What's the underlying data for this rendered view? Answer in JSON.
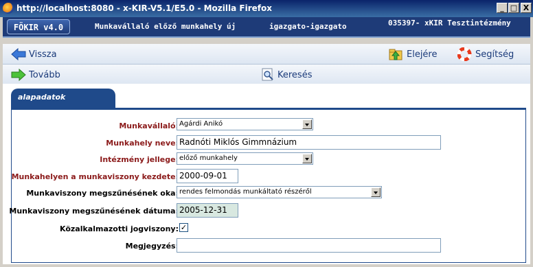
{
  "window": {
    "title": "http://localhost:8080 - x-KIR-V5.1/E5.0 - Mozilla Firefox",
    "buttons": {
      "minimize": "_",
      "maximize": "□",
      "close": "X"
    }
  },
  "header": {
    "logo": "FÖKIR v4.0",
    "page_title": "Munkavállaló előző munkahely új",
    "user": "igazgato-igazgato",
    "institution": "035397- xKIR Tesztintézmény"
  },
  "toolbar1": {
    "back": "Vissza",
    "top": "Elejére",
    "help": "Segítség"
  },
  "toolbar2": {
    "next": "Tovább",
    "search": "Keresés"
  },
  "tab": {
    "label": "alapadatok"
  },
  "form": {
    "employee": {
      "label": "Munkavállaló:",
      "value": "Agárdi Anikó"
    },
    "workplace_name": {
      "label": "Munkahely neve:",
      "value": "Radnóti Miklós Gimmnázium"
    },
    "institution_type": {
      "label": "Intézmény jellege:",
      "value": "előző munkahely"
    },
    "start_date": {
      "label": "Munkahelyen a munkaviszony kezdete:",
      "value": "2000-09-01"
    },
    "termination_reason": {
      "label": "Munkaviszony megszűnésének oka:",
      "value": "rendes felmondás munkáltató részéről"
    },
    "termination_date": {
      "label": "Munkaviszony megszűnésének dátuma:",
      "value": "2005-12-31"
    },
    "public_employee": {
      "label": "Közalkalmazotti jogviszony:",
      "checked": "✓"
    },
    "note": {
      "label": "Megjegyzés:",
      "value": ""
    }
  }
}
